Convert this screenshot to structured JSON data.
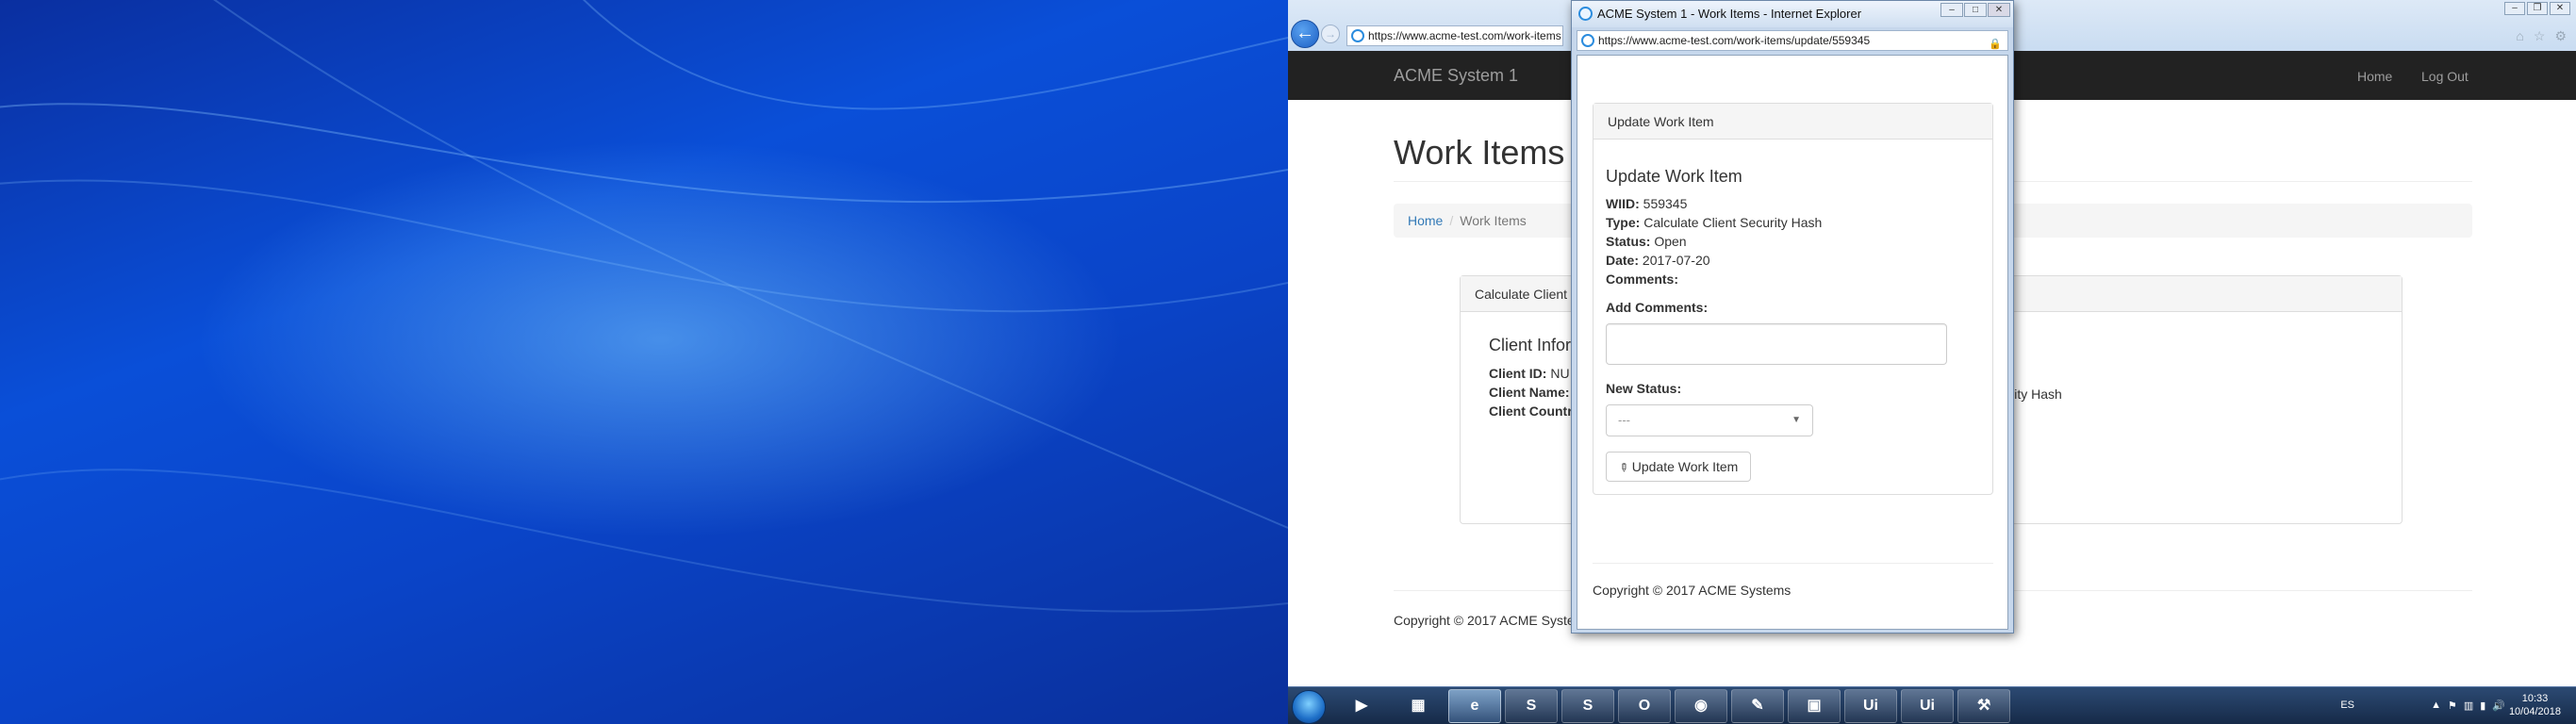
{
  "main_browser": {
    "address": "https://www.acme-test.com/work-items",
    "nav": {
      "brand": "ACME System 1",
      "home": "Home",
      "logout": "Log Out"
    },
    "page_title": "Work Items",
    "breadcrumb": {
      "home": "Home",
      "separator": "/",
      "current": "Work Items"
    },
    "panel": {
      "heading": "Calculate Client",
      "section_title": "Client Infor",
      "rows": [
        {
          "label": "Client ID:",
          "value": "NU"
        },
        {
          "label": "Client Name:",
          "value": ""
        },
        {
          "label": "Client Countr",
          "value": ""
        }
      ],
      "right_fragment": "ecurity Hash"
    },
    "footer": "Copyright © 2017 ACME Syste"
  },
  "popup": {
    "window_title": "ACME System 1 - Work Items - Internet Explorer",
    "address": "https://www.acme-test.com/work-items/update/559345",
    "panel_heading": "Update Work Item",
    "form_title": "Update Work Item",
    "fields": {
      "wiid_label": "WIID:",
      "wiid_value": "559345",
      "type_label": "Type:",
      "type_value": "Calculate Client Security Hash",
      "status_label": "Status:",
      "status_value": "Open",
      "date_label": "Date:",
      "date_value": "2017-07-20",
      "comments_label": "Comments:"
    },
    "add_comments_label": "Add Comments:",
    "new_status_label": "New Status:",
    "new_status_selected": "---",
    "submit_label": "Update Work Item",
    "footer": "Copyright © 2017 ACME Systems"
  },
  "taskbar": {
    "language": "ES",
    "time": "10:33",
    "date": "10/04/2018",
    "apps": [
      "media-player",
      "file-explorer",
      "internet-explorer",
      "skype",
      "skype-business",
      "outlook",
      "chrome",
      "notepad-plus",
      "terminal",
      "uipath-studio",
      "uipath-robot",
      "tool"
    ],
    "uipath_label": "Ui"
  }
}
